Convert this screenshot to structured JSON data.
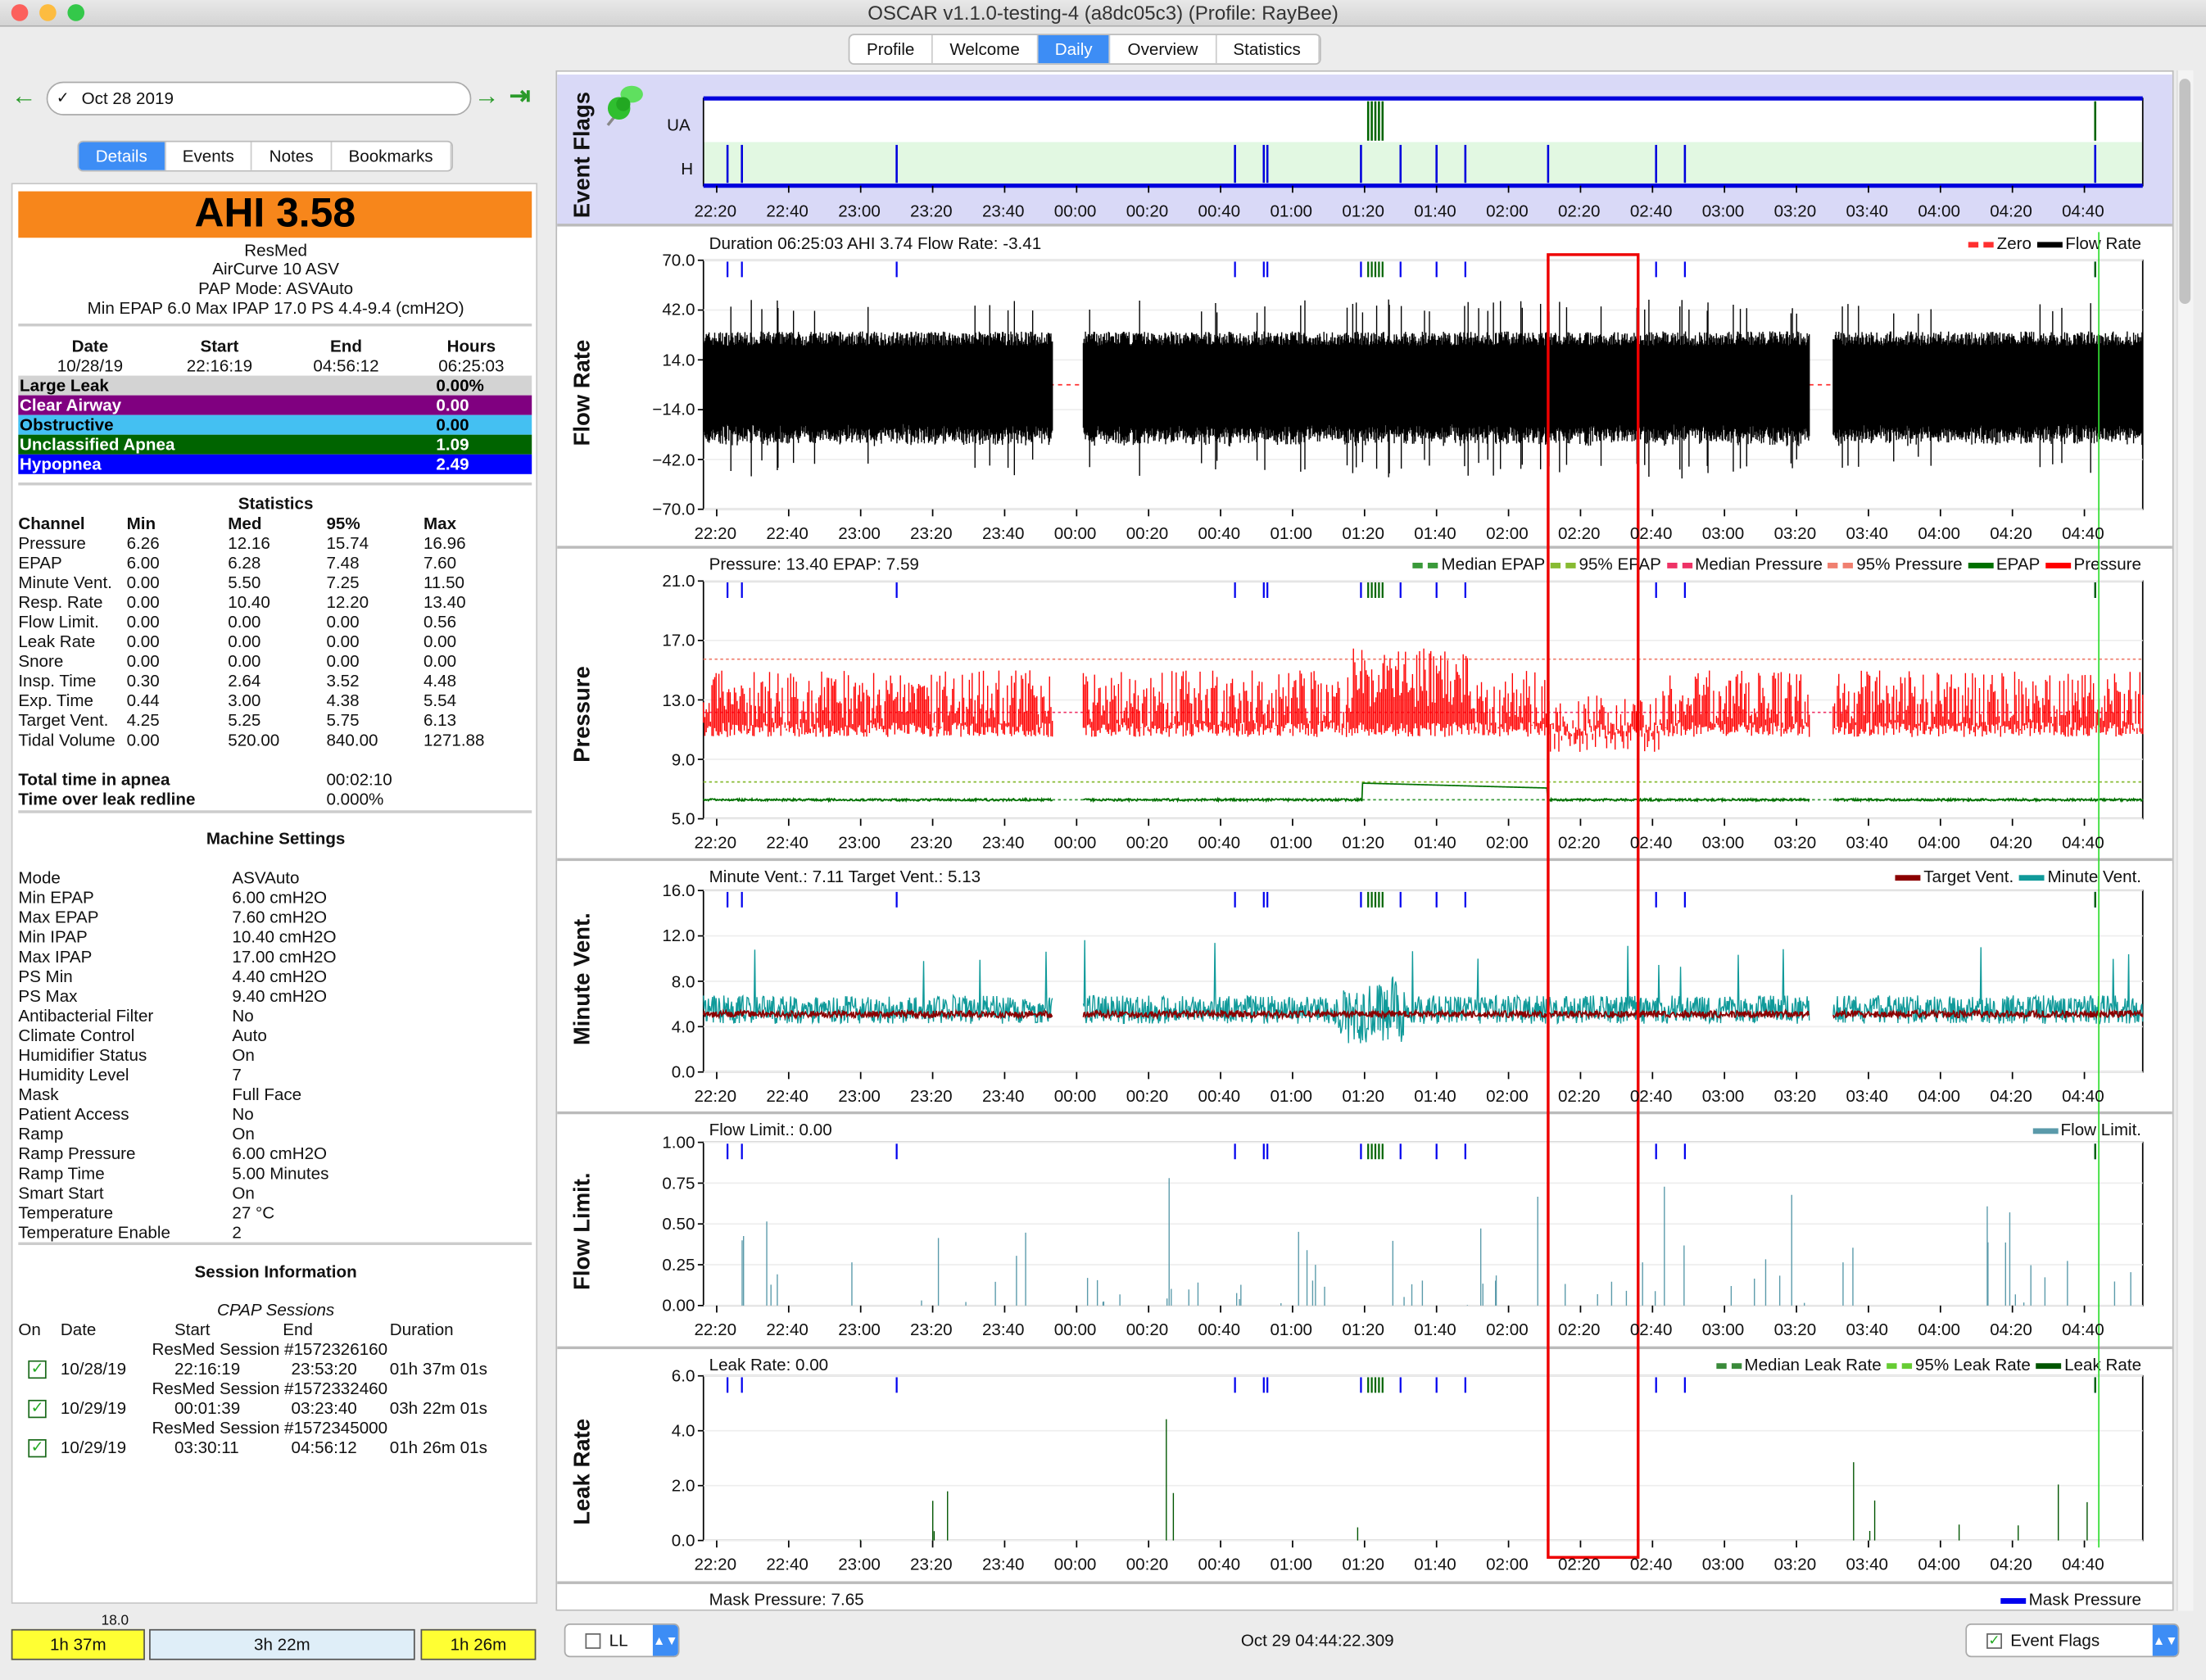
{
  "window": {
    "title": "OSCAR v1.1.0-testing-4 (a8dc05c3) (Profile: RayBee)"
  },
  "tabs": [
    {
      "label": "Profile"
    },
    {
      "label": "Welcome"
    },
    {
      "label": "Daily",
      "selected": true
    },
    {
      "label": "Overview"
    },
    {
      "label": "Statistics"
    }
  ],
  "date_nav": {
    "date": "Oct 28 2019",
    "prev_icon": "arrow-left-icon",
    "next_icon": "arrow-right-icon",
    "last_icon": "arrow-right-bar-icon"
  },
  "subtabs": [
    {
      "label": "Details",
      "selected": true
    },
    {
      "label": "Events"
    },
    {
      "label": "Notes"
    },
    {
      "label": "Bookmarks"
    }
  ],
  "summary": {
    "ahi": "AHI 3.58",
    "ahi_color": "#f7861b",
    "brand": "ResMed",
    "model": "AirCurve 10 ASV",
    "mode": "PAP Mode: ASVAuto",
    "pressures": "Min EPAP 6.0 Max IPAP 17.0 PS 4.4-9.4 (cmH2O)",
    "headers": [
      "Date",
      "Start",
      "End",
      "Hours"
    ],
    "values": [
      "10/28/19",
      "22:16:19",
      "04:56:12",
      "06:25:03"
    ],
    "events": [
      {
        "label": "Large Leak",
        "value": "0.00%",
        "bg": "#d3d3d3",
        "fg": "#000"
      },
      {
        "label": "Clear Airway",
        "value": "0.00",
        "bg": "#800080",
        "fg": "#fff"
      },
      {
        "label": "Obstructive",
        "value": "0.00",
        "bg": "#44c0f2",
        "fg": "#000"
      },
      {
        "label": "Unclassified Apnea",
        "value": "1.09",
        "bg": "#006400",
        "fg": "#fff"
      },
      {
        "label": "Hypopnea",
        "value": "2.49",
        "bg": "#0000ff",
        "fg": "#fff"
      }
    ]
  },
  "statistics": {
    "title": "Statistics",
    "headers": [
      "Channel",
      "Min",
      "Med",
      "95%",
      "Max"
    ],
    "rows": [
      [
        "Pressure",
        "6.26",
        "12.16",
        "15.74",
        "16.96"
      ],
      [
        "EPAP",
        "6.00",
        "6.28",
        "7.48",
        "7.60"
      ],
      [
        "Minute Vent.",
        "0.00",
        "5.50",
        "7.25",
        "11.50"
      ],
      [
        "Resp. Rate",
        "0.00",
        "10.40",
        "12.20",
        "13.40"
      ],
      [
        "Flow Limit.",
        "0.00",
        "0.00",
        "0.00",
        "0.56"
      ],
      [
        "Leak Rate",
        "0.00",
        "0.00",
        "0.00",
        "0.00"
      ],
      [
        "Snore",
        "0.00",
        "0.00",
        "0.00",
        "0.00"
      ],
      [
        "Insp. Time",
        "0.30",
        "2.64",
        "3.52",
        "4.48"
      ],
      [
        "Exp. Time",
        "0.44",
        "3.00",
        "4.38",
        "5.54"
      ],
      [
        "Target Vent.",
        "4.25",
        "5.25",
        "5.75",
        "6.13"
      ],
      [
        "Tidal Volume",
        "0.00",
        "520.00",
        "840.00",
        "1271.88"
      ]
    ],
    "totals": [
      [
        "Total time in apnea",
        "00:02:10"
      ],
      [
        "Time over leak redline",
        "0.000%"
      ]
    ]
  },
  "machine_settings": {
    "title": "Machine Settings",
    "rows": [
      [
        "Mode",
        "ASVAuto"
      ],
      [
        "Min EPAP",
        "6.00 cmH2O"
      ],
      [
        "Max EPAP",
        "7.60 cmH2O"
      ],
      [
        "Min IPAP",
        "10.40 cmH2O"
      ],
      [
        "Max IPAP",
        "17.00 cmH2O"
      ],
      [
        "PS Min",
        "4.40 cmH2O"
      ],
      [
        "PS Max",
        "9.40 cmH2O"
      ],
      [
        "Antibacterial Filter",
        "No"
      ],
      [
        "Climate Control",
        "Auto"
      ],
      [
        "Humidifier Status",
        "On"
      ],
      [
        "Humidity Level",
        "7"
      ],
      [
        "Mask",
        "Full Face"
      ],
      [
        "Patient Access",
        "No"
      ],
      [
        "Ramp",
        "On"
      ],
      [
        "Ramp Pressure",
        "6.00 cmH2O"
      ],
      [
        "Ramp Time",
        "5.00 Minutes"
      ],
      [
        "Smart Start",
        "On"
      ],
      [
        "Temperature",
        "27 °C"
      ],
      [
        "Temperature Enable",
        "2"
      ]
    ]
  },
  "sessions": {
    "title": "Session Information",
    "subtitle": "CPAP Sessions",
    "headers": [
      "On",
      "Date",
      "Start",
      "End",
      "Duration"
    ],
    "rows": [
      {
        "name": "ResMed Session #1572326160",
        "on": true,
        "date": "10/28/19",
        "start": "22:16:19",
        "end": "23:53:20",
        "duration": "01h 37m 01s"
      },
      {
        "name": "ResMed Session #1572332460",
        "on": true,
        "date": "10/29/19",
        "start": "00:01:39",
        "end": "03:23:40",
        "duration": "03h 22m 01s"
      },
      {
        "name": "ResMed Session #1572345000",
        "on": true,
        "date": "10/29/19",
        "start": "03:30:11",
        "end": "04:56:12",
        "duration": "01h 26m 01s"
      }
    ]
  },
  "session_bar": [
    {
      "label": "1h 37m",
      "color": "#ffff33"
    },
    {
      "label": "3h 22m",
      "color": "#dfeef8"
    },
    {
      "label": "1h 26m",
      "color": "#ffff33"
    }
  ],
  "graphs": {
    "time_range": [
      "22:16:19",
      "04:56:12"
    ],
    "x_ticks": [
      "22:20",
      "22:40",
      "23:00",
      "23:20",
      "23:40",
      "00:00",
      "00:20",
      "00:40",
      "01:00",
      "01:20",
      "01:40",
      "02:00",
      "02:20",
      "02:40",
      "03:00",
      "03:20",
      "03:40",
      "04:00",
      "04:20",
      "04:40"
    ],
    "hypopnea_events": [
      "22:23",
      "22:27",
      "23:10",
      "00:44",
      "00:52",
      "00:53",
      "01:19",
      "01:30",
      "01:40",
      "01:48",
      "02:11",
      "02:41",
      "02:49",
      "04:43"
    ],
    "unclassified_events": [
      "01:21",
      "01:22",
      "01:23",
      "01:24",
      "01:25",
      "04:43"
    ],
    "selection": [
      "02:11",
      "02:36"
    ],
    "cursor": "04:44",
    "event_flags": {
      "label": "Event Flags",
      "rows": [
        "UA",
        "H"
      ],
      "icon": "pushpin-icon"
    },
    "panels": [
      {
        "id": "flow",
        "label": "Flow Rate",
        "header": "Duration 06:25:03 AHI 3.74 Flow Rate: -3.41",
        "y_ticks": [
          "70.0",
          "42.0",
          "14.0",
          "−14.0",
          "−42.0",
          "−70.0"
        ],
        "ylim": [
          -70,
          70
        ],
        "legend": [
          {
            "name": "Zero",
            "color": "#ff3030",
            "dashed": true
          },
          {
            "name": "Flow Rate",
            "color": "#000000"
          }
        ]
      },
      {
        "id": "pressure",
        "label": "Pressure",
        "header": "Pressure: 13.40 EPAP: 7.59",
        "y_ticks": [
          "21.0",
          "17.0",
          "13.0",
          "9.0",
          "5.0"
        ],
        "ylim": [
          5,
          21
        ],
        "legend": [
          {
            "name": "Median EPAP",
            "color": "#3a9a3a",
            "dashed": true
          },
          {
            "name": "95% EPAP",
            "color": "#88bb33",
            "dashed": true
          },
          {
            "name": "Median Pressure",
            "color": "#ee3366",
            "dashed": true
          },
          {
            "name": "95% Pressure",
            "color": "#f08070",
            "dashed": true
          },
          {
            "name": "EPAP",
            "color": "#007000"
          },
          {
            "name": "Pressure",
            "color": "#ff0000"
          }
        ]
      },
      {
        "id": "minvent",
        "label": "Minute Vent.",
        "header": "Minute Vent.: 7.11 Target Vent.: 5.13",
        "y_ticks": [
          "16.0",
          "12.0",
          "8.0",
          "4.0",
          "0.0"
        ],
        "ylim": [
          0,
          16
        ],
        "legend": [
          {
            "name": "Target Vent.",
            "color": "#8b0000"
          },
          {
            "name": "Minute Vent.",
            "color": "#109a9a"
          }
        ]
      },
      {
        "id": "flowlim",
        "label": "Flow Limit.",
        "header": "Flow Limit.: 0.00",
        "y_ticks": [
          "1.00",
          "0.75",
          "0.50",
          "0.25",
          "0.00"
        ],
        "ylim": [
          0,
          1
        ],
        "legend": [
          {
            "name": "Flow Limit.",
            "color": "#5a9aaa"
          }
        ]
      },
      {
        "id": "leak",
        "label": "Leak Rate",
        "header": "Leak Rate: 0.00",
        "y_ticks": [
          "6.0",
          "4.0",
          "2.0",
          "0.0"
        ],
        "ylim": [
          0,
          6
        ],
        "legend": [
          {
            "name": "Median Leak Rate",
            "color": "#3a8a3a",
            "dashed": true
          },
          {
            "name": "95% Leak Rate",
            "color": "#66cc33",
            "dashed": true
          },
          {
            "name": "Leak Rate",
            "color": "#005500"
          }
        ]
      },
      {
        "id": "mask",
        "label": "",
        "header": "Mask Pressure: 7.65",
        "y_ticks": [
          "18.0"
        ],
        "legend": [
          {
            "name": "Mask Pressure",
            "color": "#0000ee"
          }
        ]
      }
    ]
  },
  "status": {
    "ll_label": "LL",
    "timestamp": "Oct 29 04:44:22.309",
    "event_flags_label": "Event Flags"
  }
}
